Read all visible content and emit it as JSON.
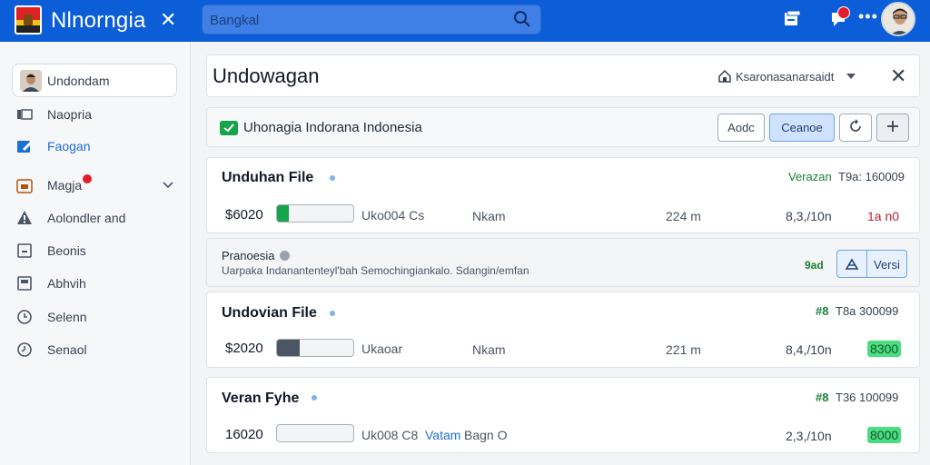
{
  "topbar": {
    "title": "Nlnorngia",
    "search_placeholder": "Bangkal",
    "icons": [
      "flag-icon",
      "close-icon",
      "search-icon",
      "print-icon",
      "notification-icon",
      "more-icon",
      "avatar"
    ],
    "more_label": "•••"
  },
  "sidebar": {
    "user_label": "Undondam",
    "items": [
      {
        "label": "Naopria",
        "icon": "folder-icon"
      },
      {
        "label": "Faogan",
        "icon": "edit-icon",
        "active": true
      },
      {
        "label": "Magja",
        "icon": "calendar-icon",
        "badge": true
      },
      {
        "label": "Aolondler and",
        "icon": "warning-icon"
      },
      {
        "label": "Beonis",
        "icon": "square-icon"
      },
      {
        "label": "Abhvih",
        "icon": "box-icon"
      },
      {
        "label": "Selenn",
        "icon": "clock-icon"
      },
      {
        "label": "Senaol",
        "icon": "clock-icon"
      }
    ]
  },
  "header": {
    "title": "Undowagan",
    "home_label": "Ksaronasanarsaidt",
    "close": "✕"
  },
  "toolbar": {
    "label": "Uhonagia Indorana Indonesia",
    "add_button": "Aodc",
    "save_button": "Ceanoe"
  },
  "files": [
    {
      "title": "Unduhan File",
      "version": "Verazan",
      "version_num": "T9a: 160009",
      "price": "$6020",
      "progress": 0.15,
      "progress_color": "#16a34a",
      "code": "Uko004 Cs",
      "type": "Nkam",
      "size": "224 m",
      "amount": "8,3,/10n",
      "status": "1a n0",
      "status_style": "red"
    },
    {
      "title": "Undovian File",
      "version": "#8",
      "version_num": "T8a 300099",
      "price": "$2020",
      "progress": 0.3,
      "progress_color": "#4b5563",
      "code": "Ukaoar",
      "type": "Nkam",
      "size": "221 m",
      "amount": "8,4,/10n",
      "status": "8300",
      "status_style": "green"
    },
    {
      "title": "Veran Fyhe",
      "version": "#8",
      "version_num": "T36 100099",
      "price": "16020",
      "progress": 0.0,
      "progress_color": "#9ca3af",
      "code": "Uk008 C8",
      "code_highlight": "Vatam",
      "code_suffix": "Bagn O",
      "type": "",
      "size": "",
      "amount": "2,3,/10n",
      "status": "8000",
      "status_style": "green"
    }
  ],
  "note": {
    "title": "Pranoesia",
    "desc": "Uarpaka Indanantenteyl'bah Semochingiankalo. Sdangin/emfan",
    "flag": "9ad",
    "button": "Versi"
  }
}
